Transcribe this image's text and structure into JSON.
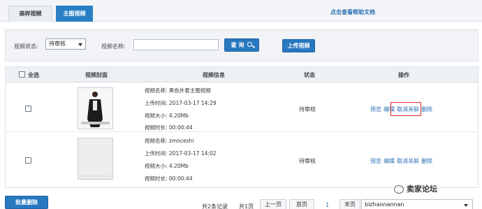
{
  "tabs": [
    {
      "label": "商样视频",
      "active": false
    },
    {
      "label": "主图视频",
      "active": true
    }
  ],
  "help_link": "点击查看帮助文档",
  "filter": {
    "status_label": "视频状态:",
    "status_value": "待审核",
    "name_label": "视频名称:",
    "name_value": "",
    "query_button": "查 询",
    "upload_button": "上传视频"
  },
  "table": {
    "headers": {
      "select_all": "全选",
      "cover": "视频封面",
      "info": "视频信息",
      "status": "状态",
      "action": "操作"
    },
    "rows": [
      {
        "name_line": "视频名称: 黑色外套主图视频",
        "time_line": "上传时间: 2017-03-17 14:29",
        "size_line": "视频大小: 4.20Mb",
        "duration_line": "视频时长: 00:00:44",
        "status": "待审核",
        "ops": [
          "预览",
          "编辑",
          "取消关联",
          "删除"
        ]
      },
      {
        "name_line": "视频名称: zmnceshi",
        "time_line": "上传时间: 2017-03-17 14:02",
        "size_line": "视频大小: 4.20Mb",
        "duration_line": "视频时长: 00:00:44",
        "status": "待审核",
        "ops": [
          "预览",
          "编辑",
          "取消关联",
          "删除"
        ]
      }
    ]
  },
  "footer": {
    "batch_delete": "批量删除",
    "total_records": "共2条记录",
    "total_pages": "共1页",
    "prev": "上一页",
    "first": "首页",
    "current_page": "1",
    "last": "末页",
    "user": "bizhaonannan"
  },
  "watermark": "卖家论坛",
  "colors": {
    "accent": "#2878c0",
    "highlight": "#e02a2a"
  }
}
